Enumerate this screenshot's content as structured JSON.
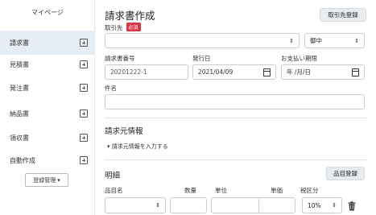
{
  "sidebar": {
    "title": "マイページ",
    "items": [
      {
        "label": "請求書"
      },
      {
        "label": "見積書"
      },
      {
        "label": "発注書"
      },
      {
        "label": "納品書"
      },
      {
        "label": "領収書"
      },
      {
        "label": "自動作成"
      }
    ],
    "register_label": "登録管理",
    "register_caret": "▾"
  },
  "header": {
    "title": "請求書作成",
    "register_client_label": "取引先登録"
  },
  "form": {
    "client_label": "取引先",
    "required_badge": "必須",
    "client_value": "",
    "honorific_value": "御中",
    "invoice_no_label": "請求書番号",
    "invoice_no_value": "20201222-1",
    "issue_date_label": "発行日",
    "issue_date_value": "2021/04/09",
    "due_date_label": "お支払い期限",
    "due_date_placeholder": "年 /月/日",
    "subject_label": "件名",
    "subject_value": ""
  },
  "billing_section": {
    "title": "請求元情報",
    "toggle_label": "▾ 請求元情報を入力する"
  },
  "details": {
    "title": "明細",
    "item_register_label": "品目登録",
    "columns": [
      "品目名",
      "数量",
      "単位",
      "単価",
      "税区分"
    ],
    "row": {
      "tax_value": "10%"
    }
  },
  "colors": {
    "active_bg": "#e7edf4",
    "badge": "#dc3545",
    "button_bg": "#e9ecef"
  },
  "icons": {
    "sidebar_add": "plus-square-icon",
    "calendar": "calendar-icon",
    "delete": "trash-icon"
  }
}
